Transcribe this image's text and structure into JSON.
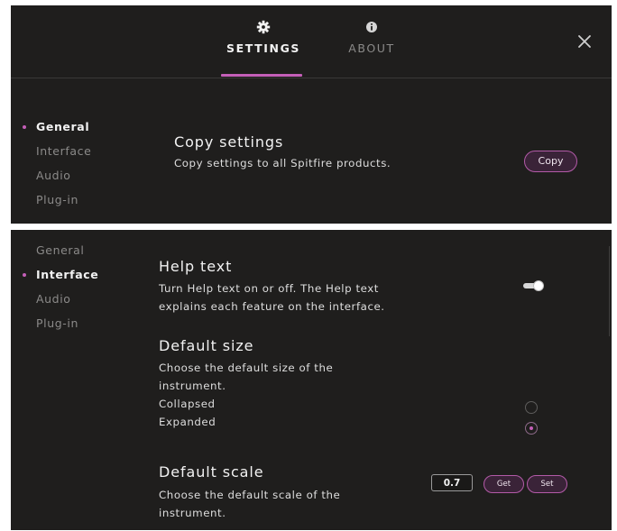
{
  "header": {
    "tabs": [
      {
        "label": "SETTINGS",
        "icon": "gear-icon",
        "active": true
      },
      {
        "label": "ABOUT",
        "icon": "info-icon",
        "active": false
      }
    ],
    "close_icon": "close-icon"
  },
  "top_panel": {
    "sidebar": {
      "items": [
        {
          "label": "General",
          "active": true
        },
        {
          "label": "Interface",
          "active": false
        },
        {
          "label": "Audio",
          "active": false
        },
        {
          "label": "Plug-in",
          "active": false
        }
      ]
    },
    "copy_settings": {
      "title": "Copy settings",
      "description": "Copy settings to all Spitfire products.",
      "button_label": "Copy"
    }
  },
  "bottom_panel": {
    "sidebar": {
      "items": [
        {
          "label": "General",
          "active": false
        },
        {
          "label": "Interface",
          "active": true
        },
        {
          "label": "Audio",
          "active": false
        },
        {
          "label": "Plug-in",
          "active": false
        }
      ]
    },
    "help_text": {
      "title": "Help text",
      "description_line1": "Turn Help text on or off. The Help text",
      "description_line2": "explains each feature on the interface.",
      "enabled": true
    },
    "default_size": {
      "title": "Default size",
      "description_line1": "Choose the default size of the",
      "description_line2": "instrument.",
      "options": [
        {
          "label": "Collapsed",
          "selected": false
        },
        {
          "label": "Expanded",
          "selected": true
        }
      ]
    },
    "default_scale": {
      "title": "Default scale",
      "description_line1": "Choose the default scale of the",
      "description_line2": "instrument.",
      "value": "0.7",
      "get_label": "Get",
      "set_label": "Set"
    }
  },
  "colors": {
    "background": "#1f1e1d",
    "accent": "#c45fb8",
    "button_fill": "#3a2338",
    "text_primary": "#f2f2f2",
    "text_muted": "#8b8a89"
  }
}
